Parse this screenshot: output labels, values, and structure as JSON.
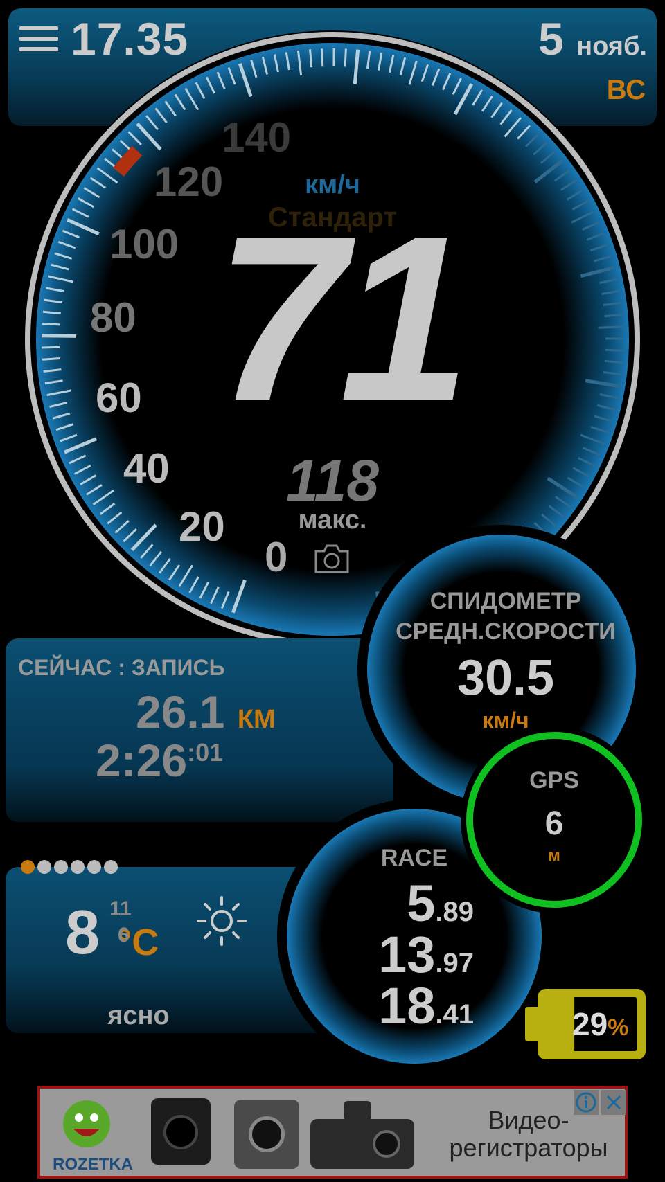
{
  "header": {
    "time": "17.35",
    "date_day": "5",
    "date_month": "нояб.",
    "weekday": "ВС"
  },
  "speedometer": {
    "unit": "км/ч",
    "mode": "Стандарт",
    "current_speed": "71",
    "max_speed": "118",
    "max_label": "макс.",
    "scale_labels": [
      "0",
      "20",
      "40",
      "60",
      "80",
      "100",
      "120",
      "140"
    ],
    "camera_icon": "camera-icon"
  },
  "avg_speed": {
    "title_line1": "СПИДОМЕТР",
    "title_line2": "СРЕДН.СКОРОСТИ",
    "value": "30.5",
    "unit": "км/ч"
  },
  "gps": {
    "label": "GPS",
    "value": "6",
    "unit": "м"
  },
  "trip": {
    "title": "СЕЙЧАС : ЗАПИСЬ",
    "distance": "26.1",
    "distance_unit": "КМ",
    "time_main": "2:26",
    "time_sec": ":01"
  },
  "weather": {
    "temp": "8",
    "temp_max": "11",
    "temp_min": "6",
    "unit": "°C",
    "condition": "ясно",
    "icon": "sun-icon",
    "page_dots": 6
  },
  "race": {
    "label": "RACE",
    "rows": [
      {
        "main": "5",
        "dec": ".89"
      },
      {
        "main": "13",
        "dec": ".97"
      },
      {
        "main": "18",
        "dec": ".41"
      }
    ]
  },
  "battery": {
    "level": "29",
    "pct": "%",
    "fraction": 0.29
  },
  "ad": {
    "brand": "ROZETKA",
    "text_line1": "Видео-",
    "text_line2": "регистраторы"
  },
  "colors": {
    "accent_orange": "#c97a0f",
    "gauge_blue": "#1a78b4",
    "gps_ring": "#10c020",
    "battery": "#b8b010"
  }
}
